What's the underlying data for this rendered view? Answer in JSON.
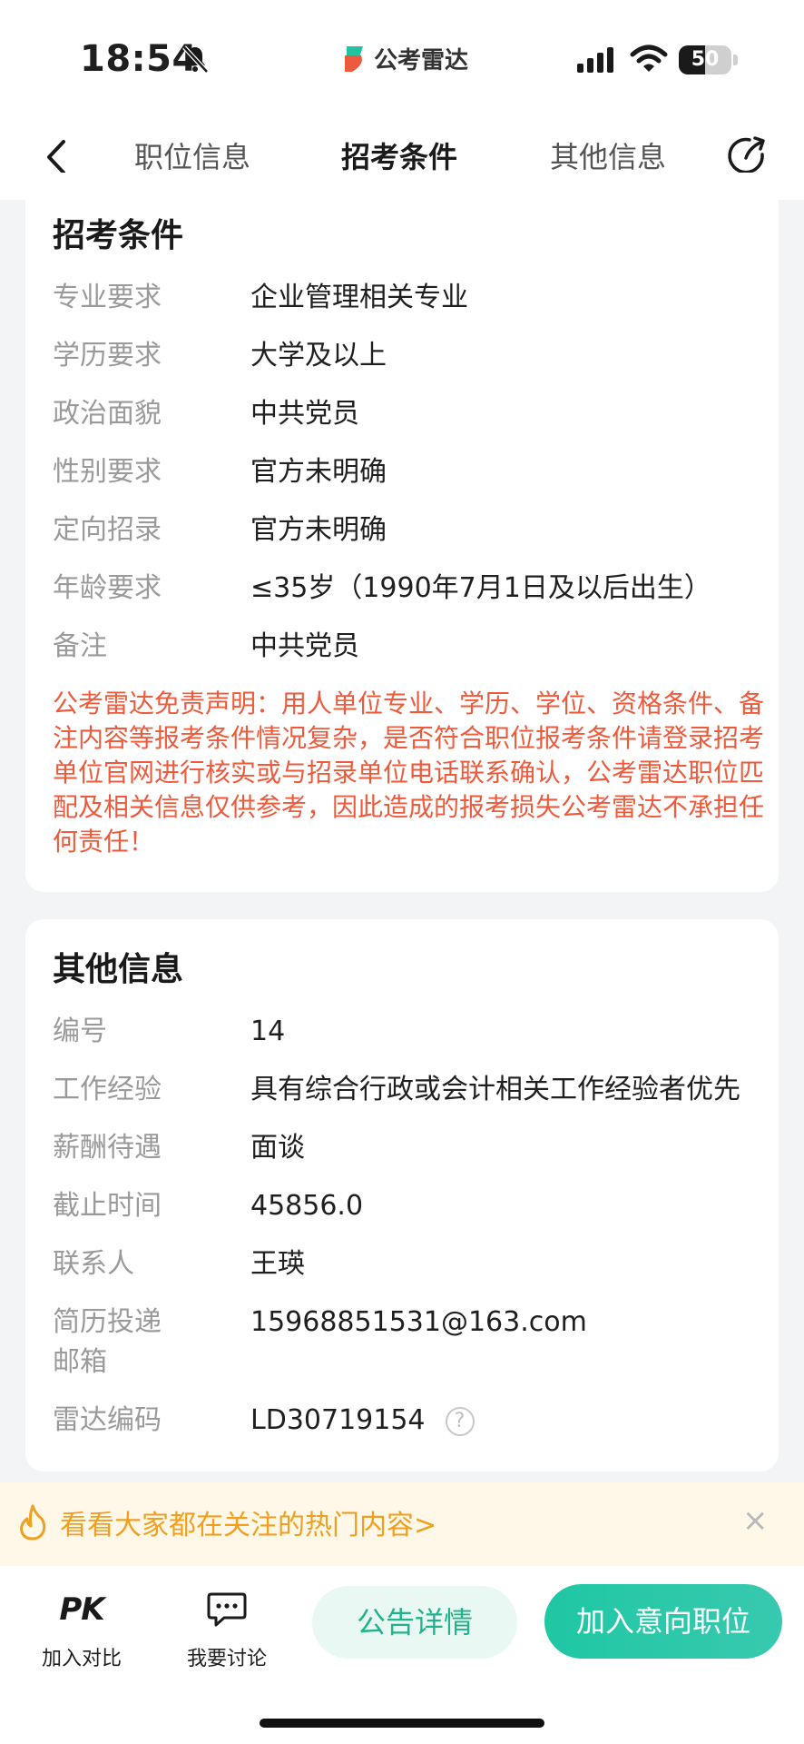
{
  "status_bar": {
    "time": "18:54",
    "app_name": "公考雷达",
    "battery": "50",
    "battery_level": 0.5,
    "icons": [
      "bell-muted-icon",
      "signal-icon",
      "wifi-icon",
      "battery-icon"
    ]
  },
  "nav": {
    "tabs": [
      {
        "label": "职位信息",
        "active": false
      },
      {
        "label": "招考条件",
        "active": true
      },
      {
        "label": "其他信息",
        "active": false
      }
    ],
    "accent": "#22c4a0"
  },
  "requirements": {
    "title": "招考条件",
    "rows": [
      {
        "label": "专业要求",
        "value": "企业管理相关专业"
      },
      {
        "label": "学历要求",
        "value": "大学及以上"
      },
      {
        "label": "政治面貌",
        "value": "中共党员"
      },
      {
        "label": "性别要求",
        "value": "官方未明确"
      },
      {
        "label": "定向招录",
        "value": "官方未明确"
      },
      {
        "label": "年龄要求",
        "value": "≤35岁（1990年7月1日及以后出生）"
      },
      {
        "label": "备注",
        "value": "中共党员"
      }
    ],
    "disclaimer": "公考雷达免责声明：用人单位专业、学历、学位、资格条件、备注内容等报考条件情况复杂，是否符合职位报考条件请登录招考单位官网进行核实或与招录单位电话联系确认，公考雷达职位匹配及相关信息仅供参考，因此造成的报考损失公考雷达不承担任何责任！",
    "disclaimer_color": "#ee5a3b"
  },
  "other_info": {
    "title": "其他信息",
    "rows": [
      {
        "label": "编号",
        "value": "14"
      },
      {
        "label": "工作经验",
        "value": "具有综合行政或会计相关工作经验者优先"
      },
      {
        "label": "薪酬待遇",
        "value": "面谈"
      },
      {
        "label": "截止时间",
        "value": "45856.0"
      },
      {
        "label": "联系人",
        "value": "王瑛"
      }
    ],
    "email_label_1": "简历投递",
    "email_label_2": "邮箱",
    "email_value": "15968851531@163.com",
    "radar_label": "雷达编码",
    "radar_value": "LD30719154",
    "help_glyph": "?"
  },
  "hot_banner": {
    "text": "看看大家都在关注的热门内容>",
    "close": "×",
    "color": "#f0a020"
  },
  "bottom_bar": {
    "pk_glyph": "PK",
    "compare_label": "加入对比",
    "discuss_label": "我要讨论",
    "notice_button": "公告详情",
    "add_button": "加入意向职位"
  }
}
